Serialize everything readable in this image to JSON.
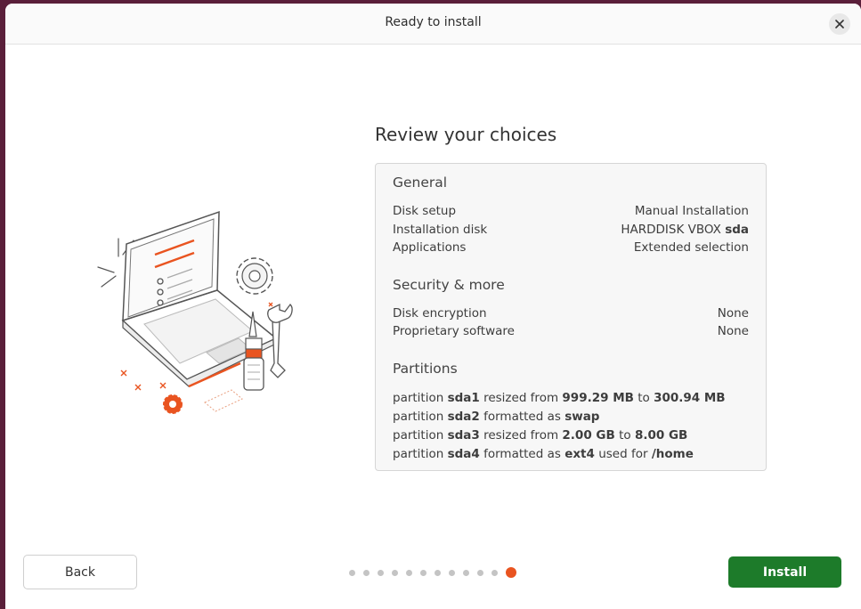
{
  "window": {
    "title": "Ready to install"
  },
  "main": {
    "heading": "Review your choices",
    "general": {
      "title": "General",
      "rows": [
        {
          "label": "Disk setup",
          "value": "Manual Installation"
        },
        {
          "label": "Installation disk",
          "value_prefix": "HARDDISK VBOX ",
          "value_bold": "sda"
        },
        {
          "label": "Applications",
          "value": "Extended selection"
        }
      ]
    },
    "security": {
      "title": "Security & more",
      "rows": [
        {
          "label": "Disk encryption",
          "value": "None"
        },
        {
          "label": "Proprietary software",
          "value": "None"
        }
      ]
    },
    "partitions": {
      "title": "Partitions",
      "items": [
        {
          "p1": "partition ",
          "b1": "sda1",
          "p2": " resized from ",
          "b2": "999.29 MB",
          "p3": " to ",
          "b3": "300.94 MB"
        },
        {
          "p1": "partition ",
          "b1": "sda2",
          "p2": " formatted as ",
          "b2": "swap"
        },
        {
          "p1": "partition ",
          "b1": "sda3",
          "p2": " resized from ",
          "b2": "2.00 GB",
          "p3": " to ",
          "b3": "8.00 GB"
        },
        {
          "p1": "partition ",
          "b1": "sda4",
          "p2": " formatted as ",
          "b2": "ext4",
          "p3": " used for ",
          "b3": "/home"
        }
      ]
    }
  },
  "footer": {
    "back_label": "Back",
    "install_label": "Install",
    "progress": {
      "total_steps": 12,
      "current_step": 12
    }
  },
  "colors": {
    "accent": "#e95420",
    "install": "#1d7b2a"
  },
  "icons": {
    "close": "close-icon"
  }
}
